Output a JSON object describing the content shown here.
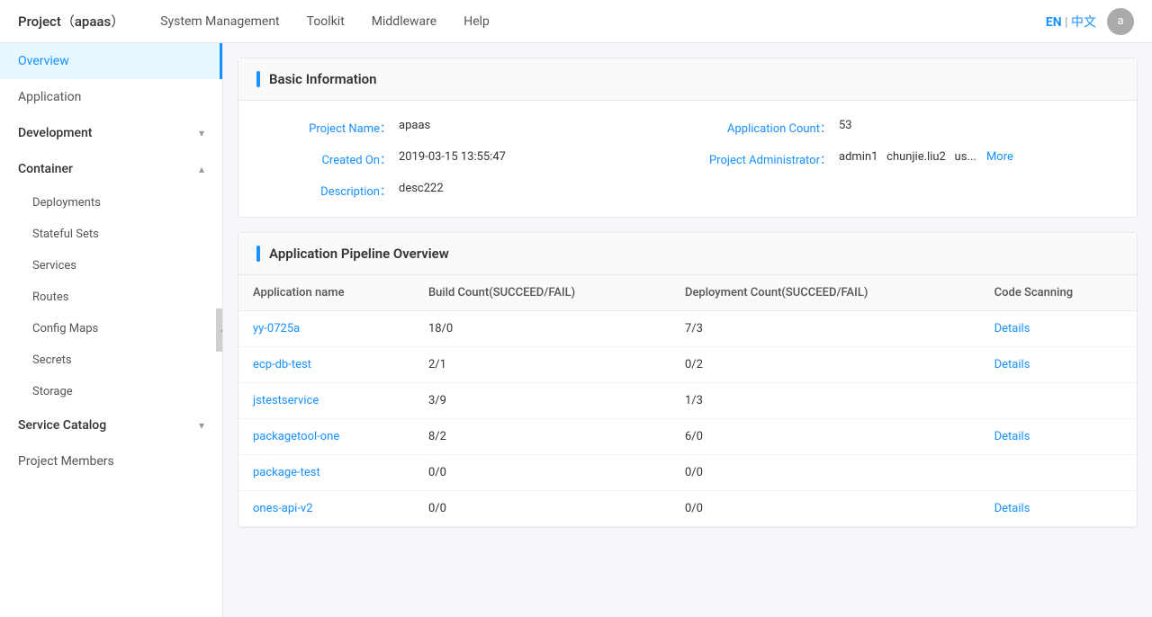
{
  "topNav": {
    "logo": "Project（apaas）",
    "items": [
      "System Management",
      "Toolkit",
      "Middleware",
      "Help"
    ],
    "lang": {
      "en": "EN",
      "separator": "|",
      "zh": "中文"
    },
    "avatar": "a"
  },
  "sidebar": {
    "overview": "Overview",
    "application": "Application",
    "development": "Development",
    "container": "Container",
    "containerSubs": [
      "Deployments",
      "Stateful Sets",
      "Services",
      "Routes",
      "Config Maps",
      "Secrets",
      "Storage"
    ],
    "serviceCatalog": "Service Catalog",
    "projectMembers": "Project Members"
  },
  "basicInfo": {
    "sectionTitle": "Basic Information",
    "projectNameLabel": "Project Name：",
    "projectNameValue": "apaas",
    "applicationCountLabel": "Application Count：",
    "applicationCountValue": "53",
    "createdOnLabel": "Created On：",
    "createdOnValue": "2019-03-15 13:55:47",
    "projectAdminLabel": "Project Administrator：",
    "projectAdminValues": [
      "admin1",
      "chunjie.liu2",
      "us..."
    ],
    "moreLabel": "More",
    "descriptionLabel": "Description：",
    "descriptionValue": "desc222"
  },
  "pipelineOverview": {
    "sectionTitle": "Application Pipeline Overview",
    "columns": [
      "Application name",
      "Build Count(SUCCEED/FAIL)",
      "Deployment Count(SUCCEED/FAIL)",
      "Code Scanning"
    ],
    "rows": [
      {
        "name": "yy-0725a",
        "build": "18/0",
        "deployment": "7/3",
        "details": "Details"
      },
      {
        "name": "ecp-db-test",
        "build": "2/1",
        "deployment": "0/2",
        "details": "Details"
      },
      {
        "name": "jstestservice",
        "build": "3/9",
        "deployment": "1/3",
        "details": ""
      },
      {
        "name": "packagetool-one",
        "build": "8/2",
        "deployment": "6/0",
        "details": "Details"
      },
      {
        "name": "package-test",
        "build": "0/0",
        "deployment": "0/0",
        "details": ""
      },
      {
        "name": "ones-api-v2",
        "build": "0/0",
        "deployment": "0/0",
        "details": "Details"
      }
    ]
  },
  "collapseIcon": "«"
}
